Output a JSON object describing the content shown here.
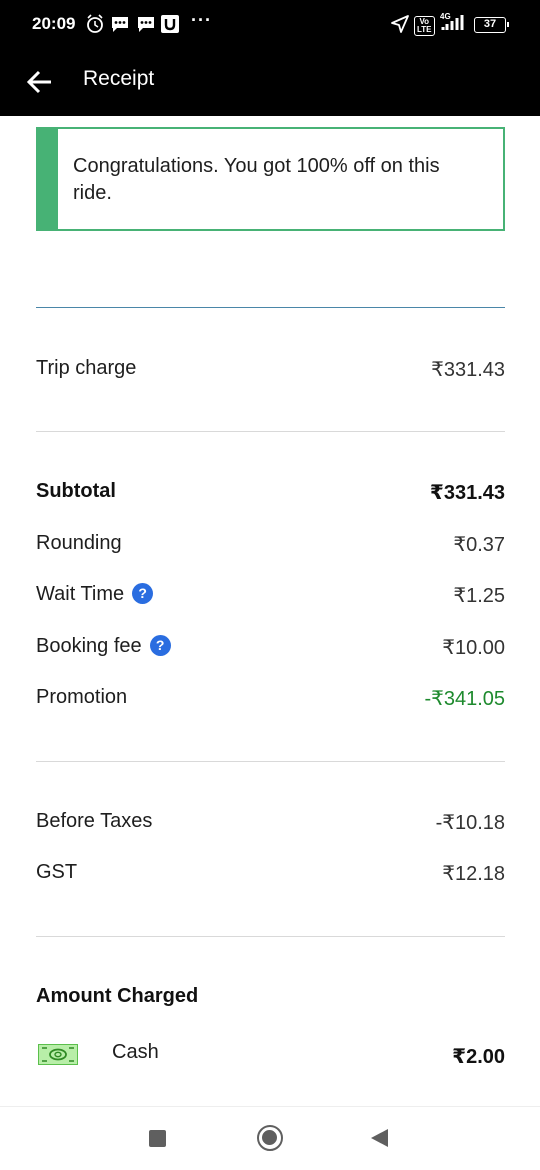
{
  "status_bar": {
    "time": "20:09",
    "network_badge": "Vo\nLTE",
    "network_type": "4G",
    "battery": "37",
    "more_indicator": "···"
  },
  "app_bar": {
    "title": "Receipt",
    "back_icon": "arrow-left-icon"
  },
  "promo_banner": {
    "text": "Congratulations. You got 100% off on this ride.",
    "accent_color": "#47b275"
  },
  "charges": {
    "trip_charge": {
      "label": "Trip charge",
      "value": "₹331.43"
    },
    "subtotal": {
      "label": "Subtotal",
      "value": "₹331.43"
    },
    "rounding": {
      "label": "Rounding",
      "value": "₹0.37"
    },
    "wait_time": {
      "label": "Wait Time",
      "value": "₹1.25",
      "help_icon": "question-circle-icon"
    },
    "booking_fee": {
      "label": "Booking fee",
      "value": "₹10.00",
      "help_icon": "question-circle-icon"
    },
    "promotion": {
      "label": "Promotion",
      "value": "-₹341.05",
      "color": "#1e8a2e"
    },
    "before_taxes": {
      "label": "Before Taxes",
      "value": "-₹10.18"
    },
    "gst": {
      "label": "GST",
      "value": "₹12.18"
    }
  },
  "amount_charged": {
    "title": "Amount Charged",
    "method_icon": "cash-icon",
    "method_label": "Cash",
    "amount": "₹2.00"
  },
  "nav_bar": {
    "recent_icon": "square-icon",
    "home_icon": "circle-icon",
    "back_icon": "triangle-back-icon"
  }
}
